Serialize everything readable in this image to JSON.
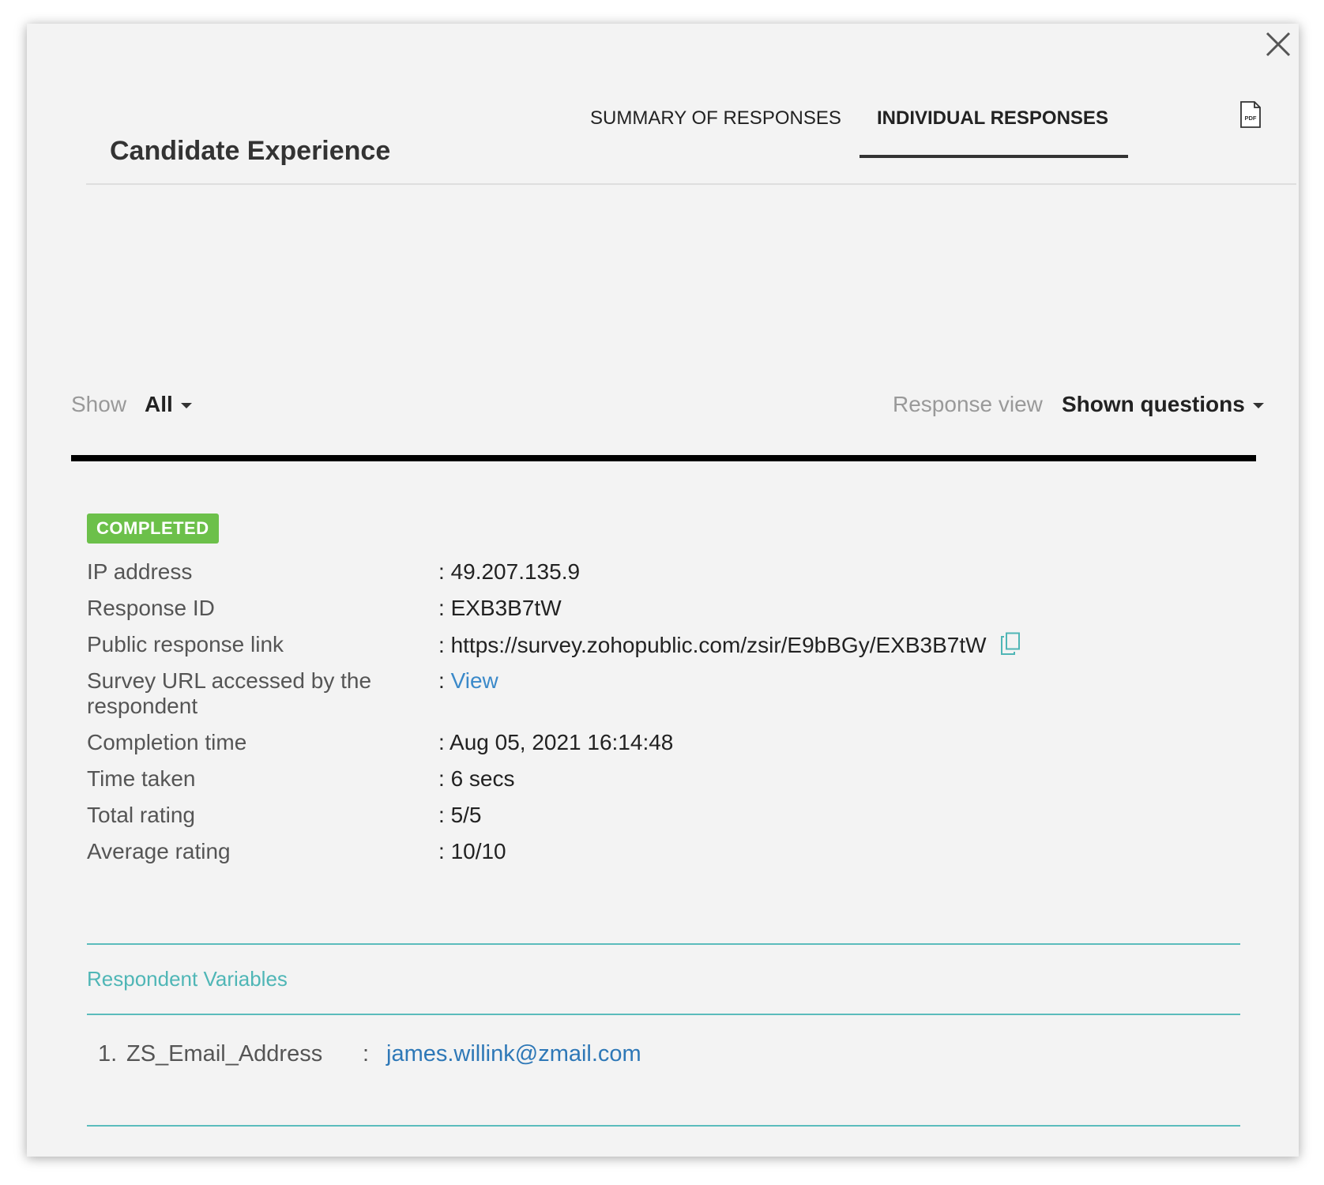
{
  "header": {
    "title": "Candidate Experience",
    "tabs": [
      {
        "label": "SUMMARY OF RESPONSES",
        "active": false
      },
      {
        "label": "INDIVIDUAL RESPONSES",
        "active": true
      }
    ],
    "pdf_icon": "pdf-file-icon",
    "pdf_icon_text": "PDF"
  },
  "filters": {
    "show_label": "Show",
    "show_value": "All",
    "view_label": "Response view",
    "view_value": "Shown questions"
  },
  "status": {
    "badge": "COMPLETED",
    "badge_color": "#6cc04a"
  },
  "details": [
    {
      "label": "IP address",
      "value": "49.207.135.9"
    },
    {
      "label": "Response ID",
      "value": "EXB3B7tW"
    },
    {
      "label": "Public response link",
      "value": "https://survey.zohopublic.com/zsir/E9bBGy/EXB3B7tW"
    },
    {
      "label": "Survey URL accessed by the respondent",
      "value": "View"
    },
    {
      "label": "Completion time",
      "value": "Aug 05, 2021 16:14:48"
    },
    {
      "label": "Time taken",
      "value": "6 secs"
    },
    {
      "label": "Total rating",
      "value": "5/5"
    },
    {
      "label": "Average rating",
      "value": "10/10"
    }
  ],
  "separator": ":",
  "respondent_variables": {
    "title": "Respondent Variables",
    "items": [
      {
        "number": "1.",
        "name": "ZS_Email_Address",
        "value": "james.willink@zmail.com"
      }
    ]
  },
  "colors": {
    "accent_teal": "#5bbcbc",
    "link_blue": "#3a89c9"
  }
}
